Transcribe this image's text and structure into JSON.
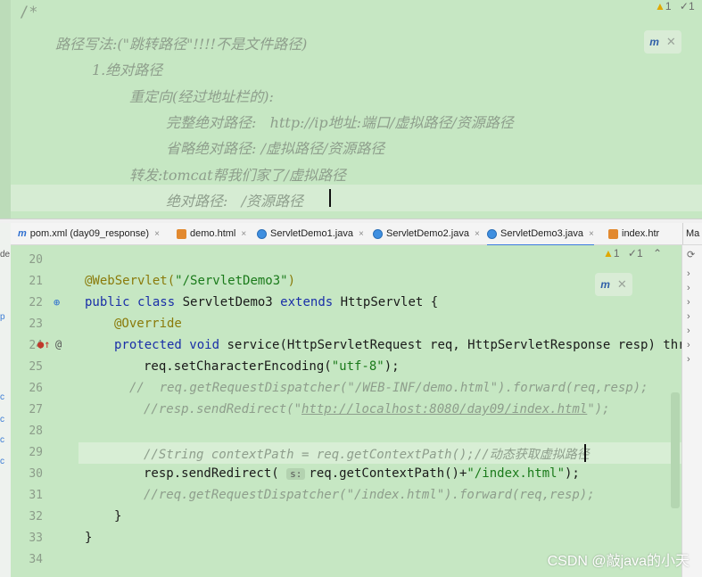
{
  "top_comment": {
    "open": "/*",
    "lines": [
      "路径写法:(\"跳转路径\"!!!!不是文件路径)",
      "1.绝对路径",
      "重定向(经过地址栏的):",
      "完整绝对路径:   http://ip地址:端口/虚拟路径/资源路径",
      "省略绝对路径: /虚拟路径/资源路径",
      "转发:tomcat帮我们家了/虚拟路径",
      "绝对路径:   /资源路径"
    ],
    "badge_warn": "1",
    "badge_up": "1"
  },
  "tabs": [
    {
      "label": "pom.xml (day09_response)",
      "icon": "maven-icon",
      "close": "×"
    },
    {
      "label": "demo.html",
      "icon": "html-file-icon",
      "close": "×"
    },
    {
      "label": "ServletDemo1.java",
      "icon": "java-class-icon",
      "close": "×"
    },
    {
      "label": "ServletDemo2.java",
      "icon": "java-class-icon",
      "close": "×"
    },
    {
      "label": "ServletDemo3.java",
      "icon": "java-class-icon",
      "close": "×"
    },
    {
      "label": "index.htr",
      "icon": "html-file-icon",
      "close": ""
    },
    {
      "label": "Ma",
      "icon": "",
      "close": ""
    }
  ],
  "editor": {
    "badge_warn": "1",
    "badge_up": "1",
    "line_numbers": [
      "20",
      "21",
      "22",
      "23",
      "24",
      "25",
      "26",
      "27",
      "28",
      "29",
      "30",
      "31",
      "32",
      "33",
      "34"
    ],
    "code": {
      "l21_ann": "@WebServlet(",
      "l21_str": "\"/ServletDemo3\"",
      "l21_end": ")",
      "l22_kw1": "public class",
      "l22_name": " ServletDemo3 ",
      "l22_kw2": "extends",
      "l22_end": " HttpServlet {",
      "l23": "@Override",
      "l24_kw": "protected void",
      "l24_rest": " service(HttpServletRequest req, HttpServletResponse resp) thro",
      "l25_a": "req.setCharacterEncoding(",
      "l25_str": "\"utf-8\"",
      "l25_end": ");",
      "l26_pre": "//  ",
      "l26_cmt": "req.getRequestDispatcher(\"/WEB-INF/demo.html\").forward(req,resp);",
      "l27_a": "//resp.sendRedirect(\"",
      "l27_url": "http://localhost:8080/day09/index.html",
      "l27_end": "\");",
      "l29": "//String contextPath = req.getContextPath();//动态获取虚拟路径",
      "l30_a": "resp.sendRedirect(",
      "l30_hint": "s:",
      "l30_b": "req.getContextPath()+",
      "l30_str": "\"/index.html\"",
      "l30_end": ");",
      "l31": "//req.getRequestDispatcher(\"/index.html\").forward(req,resp);",
      "l32": "}",
      "l33": "}"
    }
  },
  "left_strip_letters": [
    "de",
    "p",
    "c",
    "c",
    "c",
    "c"
  ],
  "watermark": "CSDN @敲java的小天"
}
